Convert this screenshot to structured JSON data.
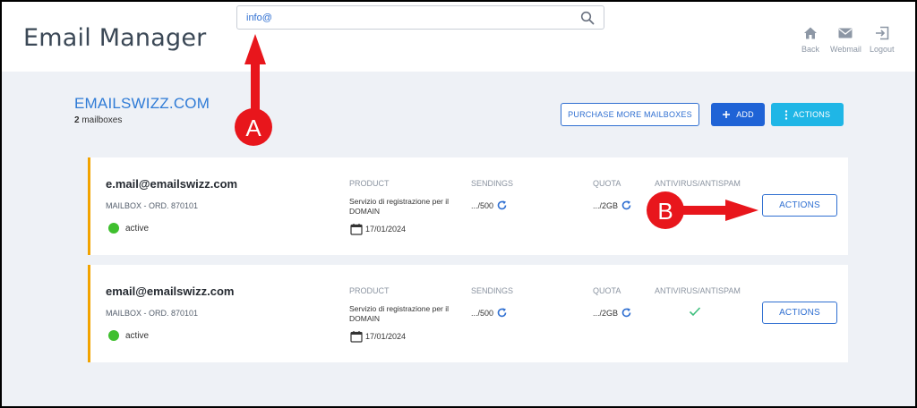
{
  "header": {
    "title": "Email Manager",
    "search_value": "info@",
    "nav": [
      {
        "label": "Back",
        "icon": "home-icon"
      },
      {
        "label": "Webmail",
        "icon": "mail-icon"
      },
      {
        "label": "Logout",
        "icon": "logout-icon"
      }
    ]
  },
  "domain": {
    "name": "EMAILSWIZZ.COM",
    "count": "2",
    "count_suffix": "mailboxes"
  },
  "toolbar": {
    "purchase_label": "PURCHASE MORE MAILBOXES",
    "add_label": "ADD",
    "actions_label": "ACTIONS"
  },
  "columns": {
    "product": "PRODUCT",
    "sendings": "SENDINGS",
    "quota": "QUOTA",
    "antivirus": "ANTIVIRUS/ANTISPAM"
  },
  "mailboxes": [
    {
      "email": "e.mail@emailswizz.com",
      "order": "MAILBOX - ORD. 870101",
      "status": "active",
      "product": "Servizio di registrazione per il DOMAIN",
      "date": "17/01/2024",
      "sendings": ".../500",
      "quota": ".../2GB",
      "antivirus": false,
      "actions_label": "ACTIONS"
    },
    {
      "email": "email@emailswizz.com",
      "order": "MAILBOX - ORD. 870101",
      "status": "active",
      "product": "Servizio di registrazione per il DOMAIN",
      "date": "17/01/2024",
      "sendings": ".../500",
      "quota": ".../2GB",
      "antivirus": true,
      "actions_label": "ACTIONS"
    }
  ],
  "annotations": {
    "a": "A",
    "b": "B"
  },
  "colors": {
    "accent": "#2f6fd1",
    "add_button": "#1f63d6",
    "actions_button": "#1fb6e6",
    "card_border": "#f2a300",
    "status_active": "#3fbf2e",
    "annotation": "#e8161c"
  }
}
